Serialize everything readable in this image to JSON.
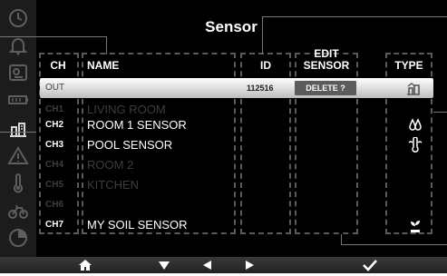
{
  "title": "Sensor",
  "headers": {
    "ch": "CH",
    "name": "NAME",
    "id": "ID",
    "edit_sensor": "EDIT SENSOR",
    "type": "TYPE"
  },
  "selected_row": {
    "ch": "OUT",
    "id": "112516",
    "action": "DELETE ?",
    "type_icon": "outdoor-sensor-icon"
  },
  "rows": [
    {
      "ch": "CH1",
      "name": "LIVING ROOM",
      "state": "inactive"
    },
    {
      "ch": "CH2",
      "name": "ROOM 1 SENSOR",
      "state": "active",
      "type_icon": "humidity-drops-icon"
    },
    {
      "ch": "CH3",
      "name": "POOL SENSOR",
      "state": "active",
      "type_icon": "pool-thermometer-icon"
    },
    {
      "ch": "CH4",
      "name": "ROOM 2",
      "state": "inactive"
    },
    {
      "ch": "CH5",
      "name": "KITCHEN",
      "state": "inactive"
    },
    {
      "ch": "CH6",
      "name": "",
      "state": "inactive"
    },
    {
      "ch": "CH7",
      "name": "MY SOIL SENSOR",
      "state": "active",
      "type_icon": "soil-plant-icon"
    }
  ],
  "sidebar_icons": [
    "clock-icon",
    "alarm-bell-icon",
    "forecast-icon",
    "battery-icon",
    "sensor-settings-icon",
    "warning-icon",
    "temperature-icon",
    "bike-icon",
    "timer-icon"
  ],
  "navbar_icons": [
    "home-icon",
    "down-arrow-icon",
    "left-arrow-icon",
    "right-arrow-icon",
    "confirm-check-icon"
  ],
  "colors": {
    "background": "#000000",
    "text": "#ffffff",
    "dimmed_text": "#3d3d3d",
    "dashed_lines": "#5a5a5a",
    "selected_row": "#d8d8d8"
  }
}
